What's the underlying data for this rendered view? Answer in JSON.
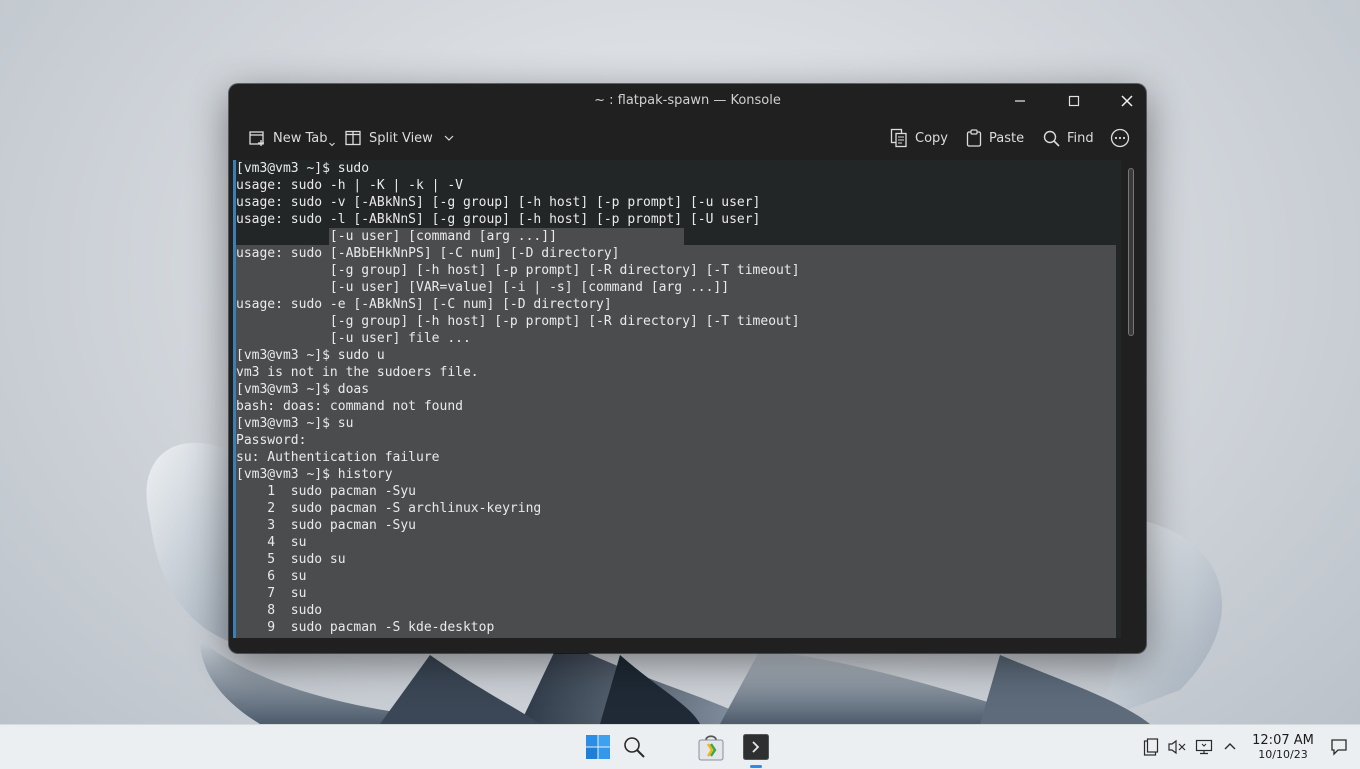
{
  "window": {
    "title": "~ : flatpak-spawn — Konsole"
  },
  "toolbar": {
    "new_tab": "New Tab",
    "split_view": "Split View",
    "copy": "Copy",
    "paste": "Paste",
    "find": "Find"
  },
  "terminal": {
    "lines": [
      "[vm3@vm3 ~]$ sudo",
      "usage: sudo -h | -K | -k | -V",
      "usage: sudo -v [-ABkNnS] [-g group] [-h host] [-p prompt] [-u user]",
      "usage: sudo -l [-ABkNnS] [-g group] [-h host] [-p prompt] [-U user]",
      "            [-u user] [command [arg ...]]",
      "usage: sudo [-ABbEHkNnPS] [-C num] [-D directory]",
      "            [-g group] [-h host] [-p prompt] [-R directory] [-T timeout]",
      "            [-u user] [VAR=value] [-i | -s] [command [arg ...]]",
      "usage: sudo -e [-ABkNnS] [-C num] [-D directory]",
      "            [-g group] [-h host] [-p prompt] [-R directory] [-T timeout]",
      "            [-u user] file ...",
      "[vm3@vm3 ~]$ sudo u",
      "vm3 is not in the sudoers file.",
      "[vm3@vm3 ~]$ doas",
      "bash: doas: command not found",
      "[vm3@vm3 ~]$ su",
      "Password:",
      "su: Authentication failure",
      "[vm3@vm3 ~]$ history",
      "    1  sudo pacman -Syu",
      "    2  sudo pacman -S archlinux-keyring",
      "    3  sudo pacman -Syu",
      "    4  su",
      "    5  sudo su",
      "    6  su",
      "    7  su",
      "    8  sudo",
      "    9  sudo pacman -S kde-desktop"
    ]
  },
  "taskbar": {
    "time": "12:07 AM",
    "date": "10/10/23"
  },
  "colors": {
    "terminal_bg": "#232627",
    "selection": "#4a4c4e",
    "accent": "#3d7eb5"
  }
}
